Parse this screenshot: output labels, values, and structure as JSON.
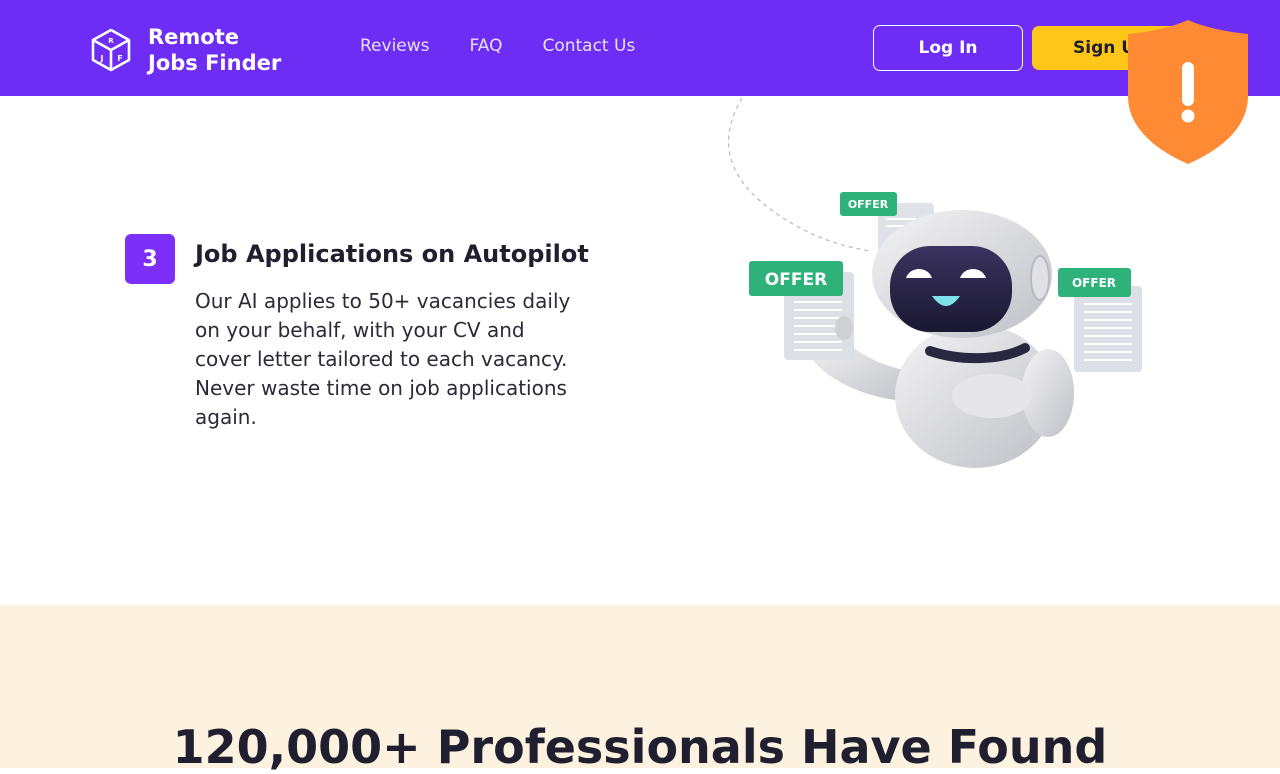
{
  "header": {
    "logo_line1": "Remote",
    "logo_line2": "Jobs Finder",
    "logo_letters": [
      "R",
      "J",
      "F"
    ],
    "nav": [
      "Reviews",
      "FAQ",
      "Contact Us"
    ],
    "login_label": "Log In",
    "signup_label": "Sign Up",
    "shield_icon": "warning-shield-icon"
  },
  "step": {
    "number": "3",
    "title": "Job Applications on Autopilot",
    "description": "Our AI applies to 50+ vacancies daily on your behalf, with your CV and cover letter tailored to each vacancy. Never waste time on job applications again."
  },
  "illustration": {
    "offer_tags": [
      "OFFER",
      "OFFER",
      "OFFER"
    ]
  },
  "stats": {
    "heading": "120,000+ Professionals Have Found"
  },
  "colors": {
    "brand_purple": "#6d2df5",
    "signup_yellow": "#ffc61a",
    "shield_orange": "#ff8a34",
    "offer_green": "#2fb27a",
    "cream": "#fdf2df"
  }
}
